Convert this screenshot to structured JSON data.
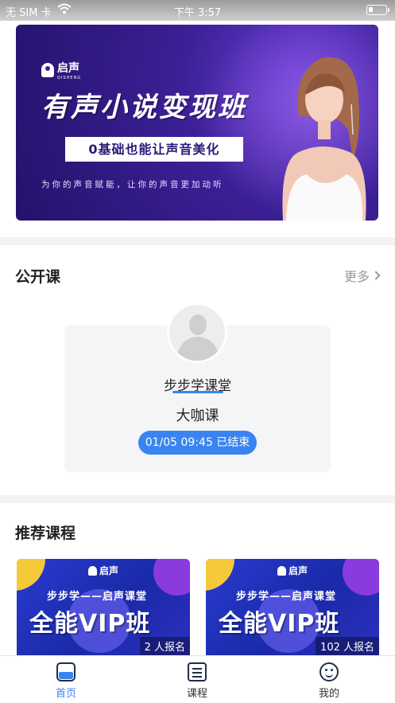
{
  "status_bar": {
    "carrier": "无 SIM 卡",
    "time": "下午 3:57"
  },
  "banner": {
    "logo_name": "启声",
    "logo_sub": "QISHENG",
    "headline": "有声小说变现班",
    "tag": "0基础也能让声音美化",
    "slogan": "为你的声音赋能，让你的声音更加动听"
  },
  "public_course": {
    "title": "公开课",
    "more": "更多",
    "card": {
      "host": "步步学课堂",
      "course_type": "大咖课",
      "status": "01/05 09:45 已结束"
    }
  },
  "recommended": {
    "title": "推荐课程",
    "items": [
      {
        "logo": "启声",
        "line1": "步步学——启声课堂",
        "line2": "全能VIP班",
        "enroll": "2 人报名"
      },
      {
        "logo": "启声",
        "line1": "步步学——启声课堂",
        "line2": "全能VIP班",
        "enroll": "102 人报名"
      }
    ]
  },
  "tabbar": {
    "items": [
      {
        "label": "首页",
        "icon": "home-icon",
        "active": true
      },
      {
        "label": "课程",
        "icon": "course-icon",
        "active": false
      },
      {
        "label": "我的",
        "icon": "profile-icon",
        "active": false
      }
    ]
  },
  "colors": {
    "accent": "#3a84f1",
    "banner": "#3b1f95"
  }
}
